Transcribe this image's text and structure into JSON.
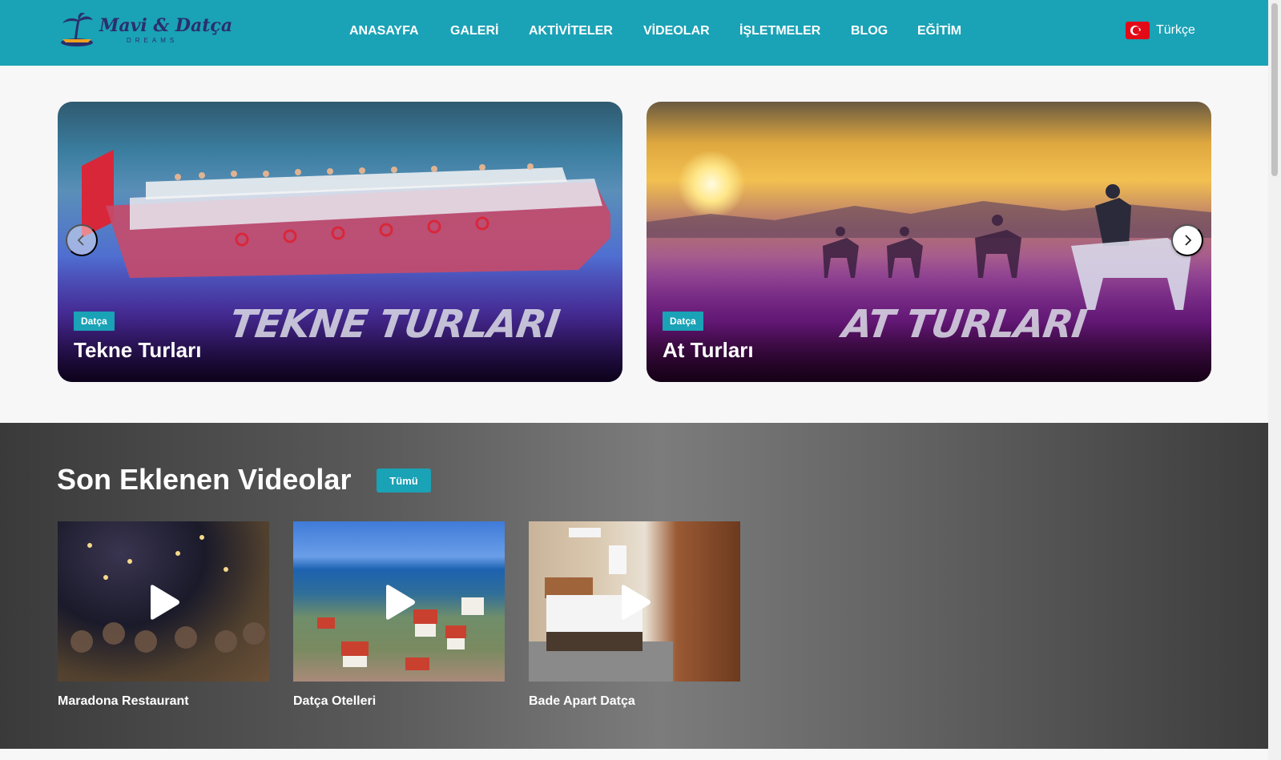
{
  "header": {
    "logo": {
      "title": "Mavi & Datça",
      "subtitle": "DREAMS"
    },
    "nav": [
      {
        "label": "ANASAYFA"
      },
      {
        "label": "GALERİ"
      },
      {
        "label": "AKTİVİTELER"
      },
      {
        "label": "VİDEOLAR"
      },
      {
        "label": "İŞLETMELER"
      },
      {
        "label": "BLOG"
      },
      {
        "label": "EĞİTİM"
      }
    ],
    "language": {
      "label": "Türkçe",
      "flag": "turkey-flag"
    }
  },
  "slider": {
    "cards": [
      {
        "badge": "Datça",
        "title": "Tekne Turları",
        "watermark": "TEKNE TURLARI"
      },
      {
        "badge": "Datça",
        "title": "At Turları",
        "watermark": "AT TURLARI"
      }
    ],
    "prev_icon": "chevron-left-icon",
    "next_icon": "chevron-right-icon"
  },
  "videos": {
    "title": "Son Eklenen Videolar",
    "all_label": "Tümü",
    "items": [
      {
        "title": "Maradona Restaurant"
      },
      {
        "title": "Datça Otelleri"
      },
      {
        "title": "Bade Apart Datça"
      }
    ]
  },
  "colors": {
    "brand": "#1aa2b6",
    "text_light": "#ffffff"
  }
}
